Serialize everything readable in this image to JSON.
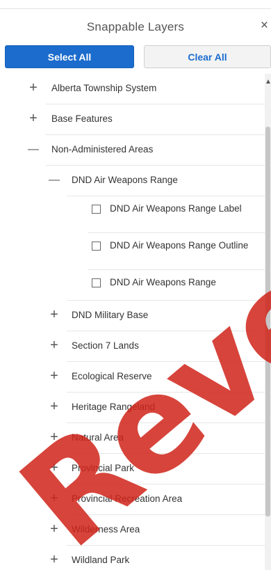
{
  "header": {
    "title": "Snappable Layers",
    "close_glyph": "×"
  },
  "buttons": {
    "select_all": "Select All",
    "clear_all": "Clear All"
  },
  "tree": [
    {
      "label": "Alberta Township System",
      "state": "collapsed",
      "toggle": "+"
    },
    {
      "label": "Base Features",
      "state": "collapsed",
      "toggle": "+"
    },
    {
      "label": "Non-Administered Areas",
      "state": "expanded",
      "toggle": "—"
    },
    {
      "label": "DND Air Weapons Range",
      "state": "expanded",
      "toggle": "—"
    },
    {
      "label": "DND Air Weapons Range Label",
      "checked": false
    },
    {
      "label": "DND Air Weapons Range Outline",
      "checked": false
    },
    {
      "label": "DND Air Weapons Range",
      "checked": false
    },
    {
      "label": "DND Military Base",
      "state": "collapsed",
      "toggle": "+"
    },
    {
      "label": "Section 7 Lands",
      "state": "collapsed",
      "toggle": "+"
    },
    {
      "label": "Ecological Reserve",
      "state": "collapsed",
      "toggle": "+"
    },
    {
      "label": "Heritage Rangeland",
      "state": "collapsed",
      "toggle": "+"
    },
    {
      "label": "Natural Area",
      "state": "collapsed",
      "toggle": "+"
    },
    {
      "label": "Provincial Park",
      "state": "collapsed",
      "toggle": "+"
    },
    {
      "label": "Provincial Recreation Area",
      "state": "collapsed",
      "toggle": "+"
    },
    {
      "label": "Wilderness Area",
      "state": "collapsed",
      "toggle": "+"
    },
    {
      "label": "Wildland Park",
      "state": "collapsed",
      "toggle": "+"
    }
  ],
  "watermark": "Reverse",
  "colors": {
    "primary": "#1b6ccd",
    "watermark": "#d02319"
  },
  "icons": {
    "close": "close-icon",
    "expand": "plus-icon",
    "collapse": "minus-icon",
    "scroll_up": "scroll-up-arrow-icon"
  }
}
